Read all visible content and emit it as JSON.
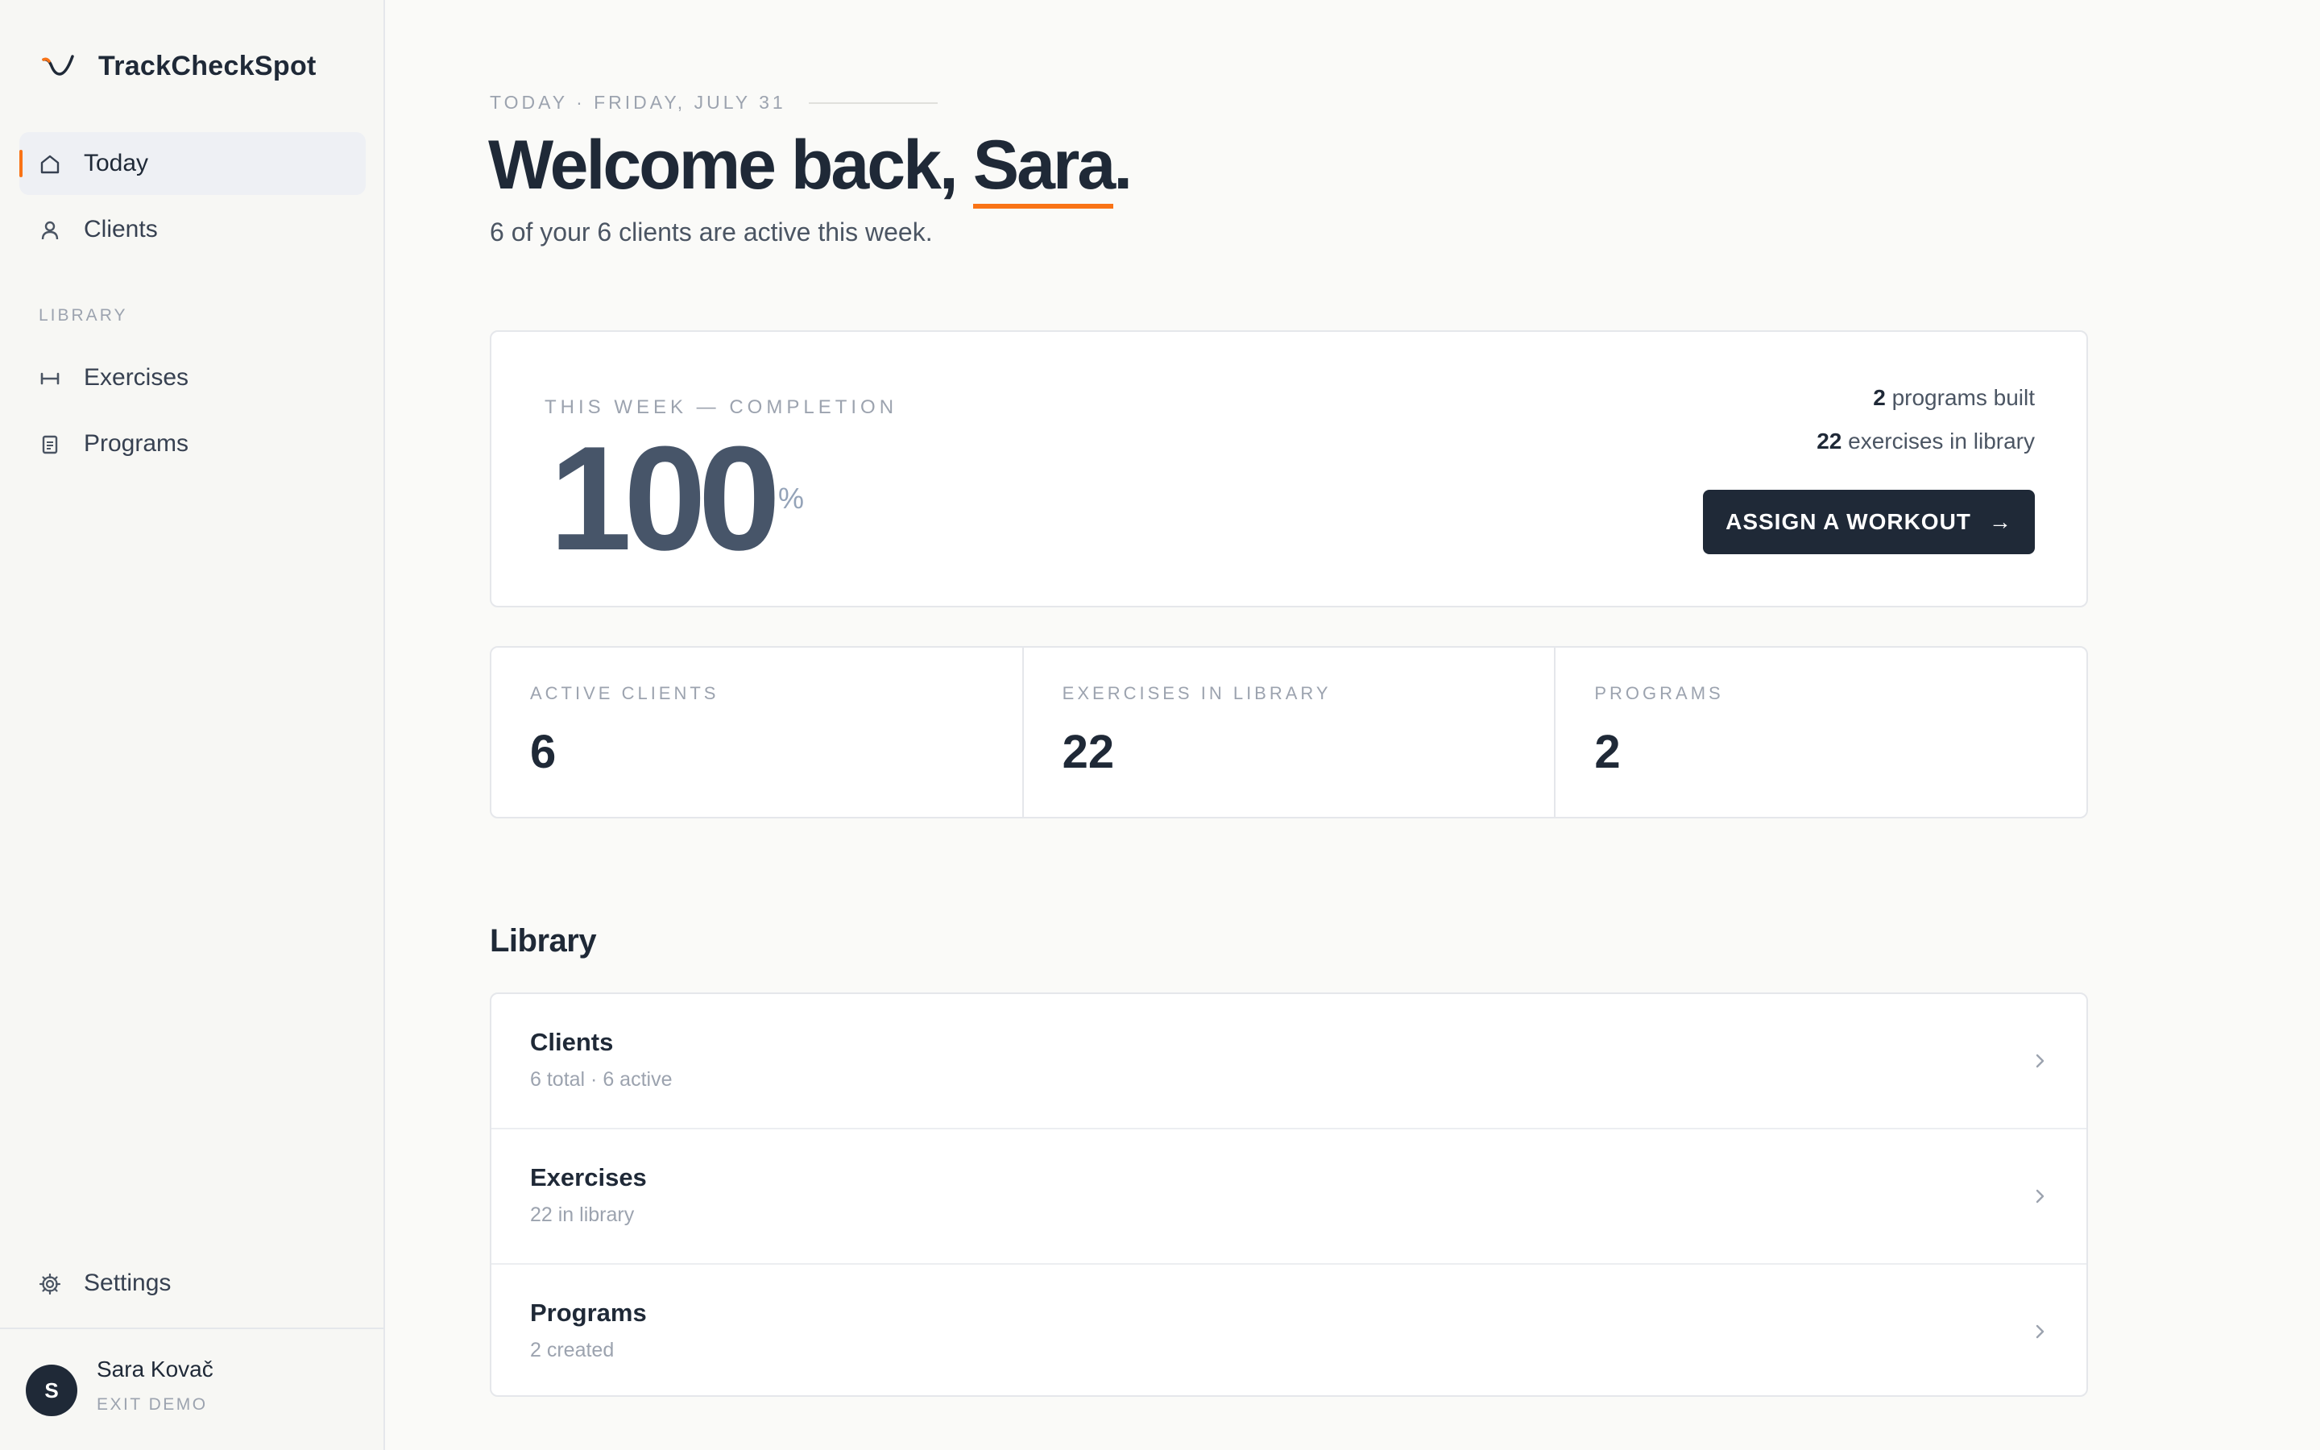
{
  "brand": {
    "name": "TrackCheckSpot"
  },
  "sidebar": {
    "items": [
      {
        "label": "Today",
        "icon": "home-icon",
        "active": true
      },
      {
        "label": "Clients",
        "icon": "user-icon"
      }
    ],
    "library_section": "LIBRARY",
    "library_items": [
      {
        "label": "Exercises",
        "icon": "dumbbell-icon"
      },
      {
        "label": "Programs",
        "icon": "document-icon"
      }
    ],
    "settings_label": "Settings",
    "user": {
      "initial": "S",
      "name": "Sara Kovač",
      "exit_label": "EXIT DEMO"
    }
  },
  "header": {
    "eyebrow": "TODAY · FRIDAY, JULY 31",
    "greeting": "Welcome back, ",
    "name": "Sara",
    "punct": ".",
    "subline": "6 of your 6 clients are active this week."
  },
  "hero": {
    "kicker": "THIS WEEK — COMPLETION",
    "value": "100",
    "unit": "%",
    "programs_count": "2",
    "programs_text": " programs built",
    "exercises_count": "22",
    "exercises_text": " exercises in library",
    "button_label": "ASSIGN A WORKOUT",
    "button_arrow": "→"
  },
  "stats": [
    {
      "label": "ACTIVE CLIENTS",
      "value": "6"
    },
    {
      "label": "EXERCISES IN LIBRARY",
      "value": "22"
    },
    {
      "label": "PROGRAMS",
      "value": "2"
    }
  ],
  "library": {
    "title": "Library",
    "rows": [
      {
        "title": "Clients",
        "sub": "6 total · 6 active"
      },
      {
        "title": "Exercises",
        "sub": "22 in library"
      },
      {
        "title": "Programs",
        "sub": "2 created"
      }
    ]
  },
  "colors": {
    "accent": "#f97316",
    "dark": "#1f2937",
    "muted": "#9ca3af"
  }
}
